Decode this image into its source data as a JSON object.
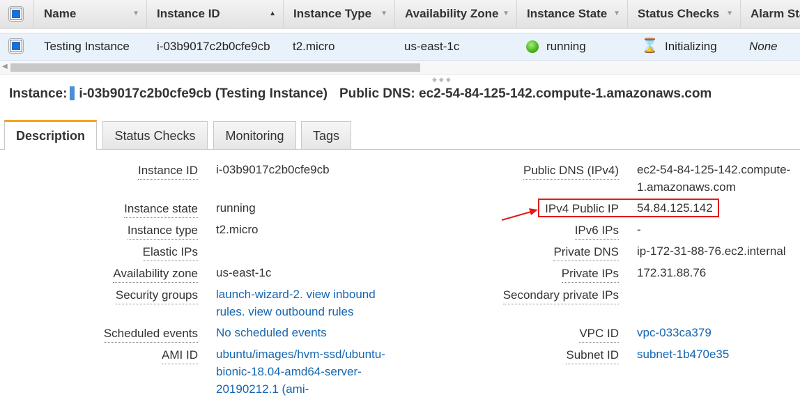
{
  "table": {
    "headers": {
      "name": "Name",
      "instance_id": "Instance ID",
      "instance_type": "Instance Type",
      "availability_zone": "Availability Zone",
      "instance_state": "Instance State",
      "status_checks": "Status Checks",
      "alarm_status": "Alarm Sta"
    },
    "row": {
      "name": "Testing Instance",
      "instance_id": "i-03b9017c2b0cfe9cb",
      "instance_type": "t2.micro",
      "availability_zone": "us-east-1c",
      "instance_state": "running",
      "status_checks": "Initializing",
      "alarm_status": "None"
    }
  },
  "summary": {
    "instance_label": "Instance:",
    "instance_value": "i-03b9017c2b0cfe9cb (Testing Instance)",
    "dns_label": "Public DNS:",
    "dns_value": "ec2-54-84-125-142.compute-1.amazonaws.com"
  },
  "tabs": [
    "Description",
    "Status Checks",
    "Monitoring",
    "Tags"
  ],
  "description": {
    "left": {
      "instance_id": {
        "label": "Instance ID",
        "value": "i-03b9017c2b0cfe9cb"
      },
      "instance_state": {
        "label": "Instance state",
        "value": "running"
      },
      "instance_type": {
        "label": "Instance type",
        "value": "t2.micro"
      },
      "elastic_ips": {
        "label": "Elastic IPs",
        "value": ""
      },
      "availability_zone": {
        "label": "Availability zone",
        "value": "us-east-1c"
      },
      "security_groups": {
        "label": "Security groups",
        "line1": "launch-wizard-2. view inbound",
        "line2": "rules. view outbound rules"
      },
      "scheduled_events": {
        "label": "Scheduled events",
        "value": "No scheduled events"
      },
      "ami_id": {
        "label": "AMI ID",
        "line1": "ubuntu/images/hvm-ssd/ubuntu-",
        "line2": "bionic-18.04-amd64-server-",
        "line3": "20190212.1 (ami-"
      }
    },
    "right": {
      "public_dns": {
        "label": "Public DNS (IPv4)",
        "line1": "ec2-54-84-125-142.compute-",
        "line2": "1.amazonaws.com"
      },
      "ipv4_public_ip": {
        "label": "IPv4 Public IP",
        "value": "54.84.125.142"
      },
      "ipv6_ips": {
        "label": "IPv6 IPs",
        "value": "-"
      },
      "private_dns": {
        "label": "Private DNS",
        "value": "ip-172-31-88-76.ec2.internal"
      },
      "private_ips": {
        "label": "Private IPs",
        "value": "172.31.88.76"
      },
      "secondary_private_ips": {
        "label": "Secondary private IPs",
        "value": ""
      },
      "vpc_id": {
        "label": "VPC ID",
        "value": "vpc-033ca379"
      },
      "subnet_id": {
        "label": "Subnet ID",
        "value": "subnet-1b470e35"
      }
    }
  },
  "colors": {
    "highlight": "#e21b1b",
    "link": "#1565b0",
    "active_tab_accent": "#f7a221",
    "selection": "#e9f2fb",
    "running": "#3ca80c"
  },
  "icons": {
    "state": "green-dot-icon",
    "status": "hourglass-icon",
    "annotation": "red-arrow-icon"
  }
}
